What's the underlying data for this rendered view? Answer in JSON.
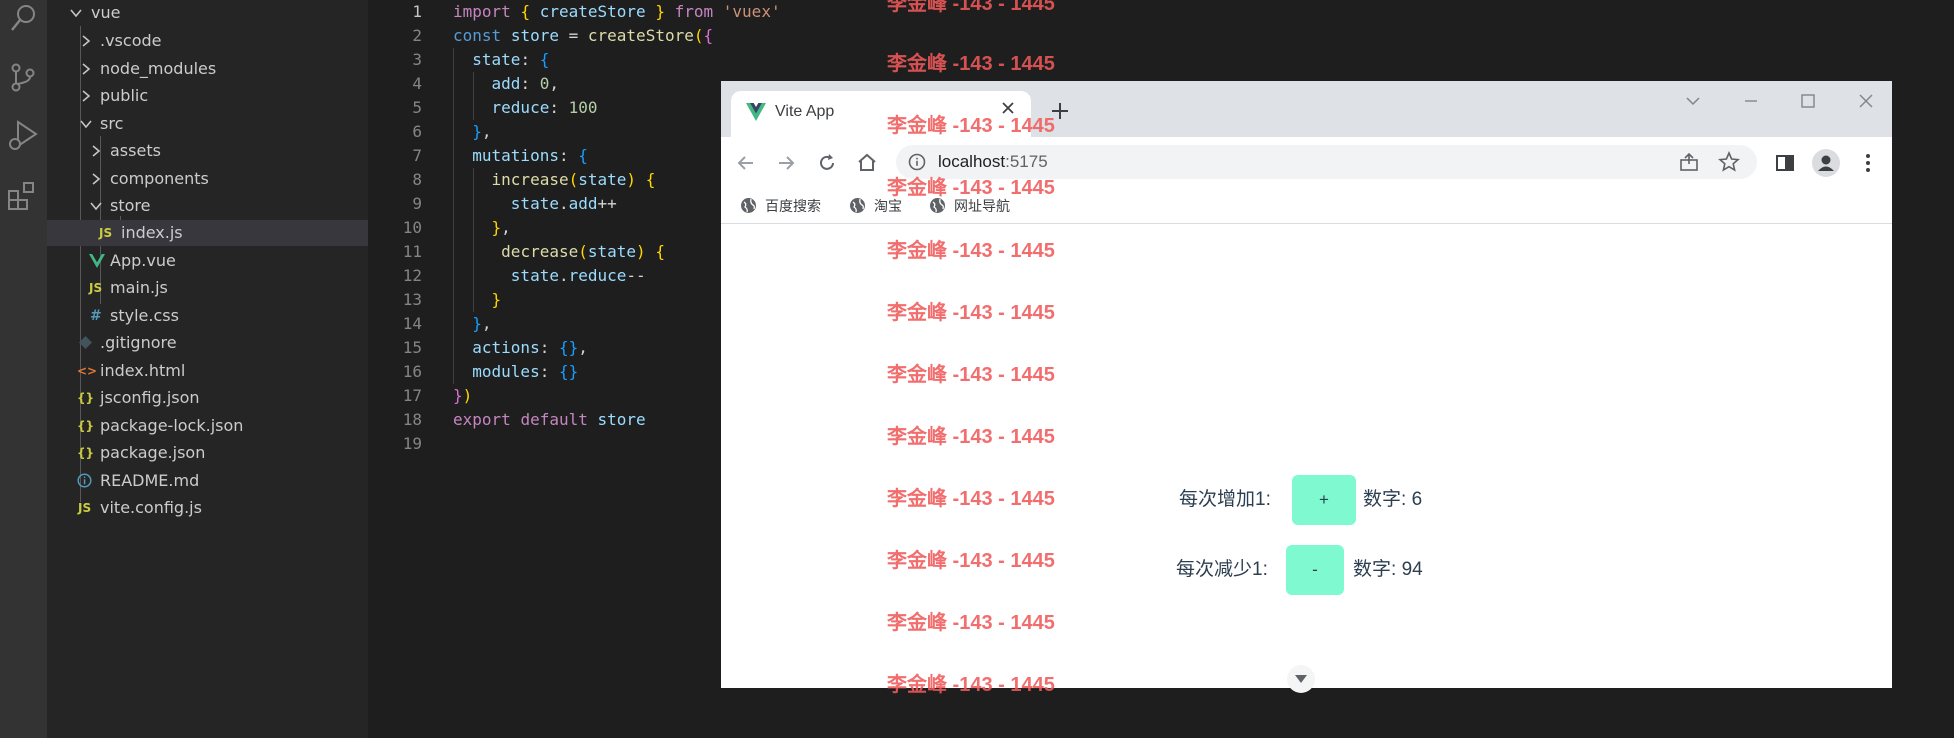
{
  "explorer": {
    "items": [
      {
        "label": "vue",
        "icon": "chevron-down-icon"
      },
      {
        "label": ".vscode",
        "icon": "chevron-right-icon"
      },
      {
        "label": "node_modules",
        "icon": "chevron-right-icon"
      },
      {
        "label": "public",
        "icon": "chevron-right-icon"
      },
      {
        "label": "src",
        "icon": "chevron-down-icon"
      },
      {
        "label": "assets",
        "icon": "chevron-right-icon"
      },
      {
        "label": "components",
        "icon": "chevron-right-icon"
      },
      {
        "label": "store",
        "icon": "chevron-down-icon"
      },
      {
        "label": "index.js",
        "icon": "js-file-icon",
        "badge": "JS"
      },
      {
        "label": "App.vue",
        "icon": "vue-file-icon"
      },
      {
        "label": "main.js",
        "icon": "js-file-icon",
        "badge": "JS"
      },
      {
        "label": "style.css",
        "icon": "css-file-icon",
        "badge": "#"
      },
      {
        "label": ".gitignore",
        "icon": "git-file-icon"
      },
      {
        "label": "index.html",
        "icon": "html-file-icon",
        "badge": "<>"
      },
      {
        "label": "jsconfig.json",
        "icon": "json-file-icon",
        "badge": "{}"
      },
      {
        "label": "package-lock.json",
        "icon": "json-file-icon",
        "badge": "{}"
      },
      {
        "label": "package.json",
        "icon": "json-file-icon",
        "badge": "{}"
      },
      {
        "label": "README.md",
        "icon": "info-file-icon"
      },
      {
        "label": "vite.config.js",
        "icon": "js-file-icon",
        "badge": "JS"
      }
    ]
  },
  "editor": {
    "line_numbers": [
      "1",
      "2",
      "3",
      "4",
      "5",
      "6",
      "7",
      "8",
      "9",
      "10",
      "11",
      "12",
      "13",
      "14",
      "15",
      "16",
      "17",
      "18",
      "19"
    ],
    "active_line": "1",
    "lines": [
      "import { createStore } from 'vuex'",
      "const store = createStore({",
      "  state: {",
      "    add: 0,",
      "    reduce: 100",
      "  },",
      "  mutations: {",
      "    increase(state) {",
      "      state.add++",
      "    },",
      "     decrease(state) {",
      "      state.reduce--",
      "    }",
      "  },",
      "  actions: {},",
      "  modules: {}",
      "})",
      "export default store",
      ""
    ]
  },
  "browser": {
    "tab_title": "Vite App",
    "tab_close": "×",
    "new_tab": "+",
    "url_host": "localhost",
    "url_port": ":5175",
    "bookmarks": [
      "百度搜索",
      "淘宝",
      "网址导航"
    ]
  },
  "app": {
    "increase": {
      "label": "每次增加1:",
      "button": "+",
      "value_label": "数字:",
      "value": "6"
    },
    "decrease": {
      "label": "每次减少1:",
      "button": "-",
      "value_label": "数字:",
      "value": "94"
    }
  },
  "watermark": {
    "text": "李金峰 -143 - 1445",
    "color": "#f05a5a"
  },
  "colors": {
    "button_bg": "#7ffad0",
    "sidebar_bg": "#252526",
    "editor_bg": "#1e1e1e",
    "activity_bg": "#333333"
  }
}
